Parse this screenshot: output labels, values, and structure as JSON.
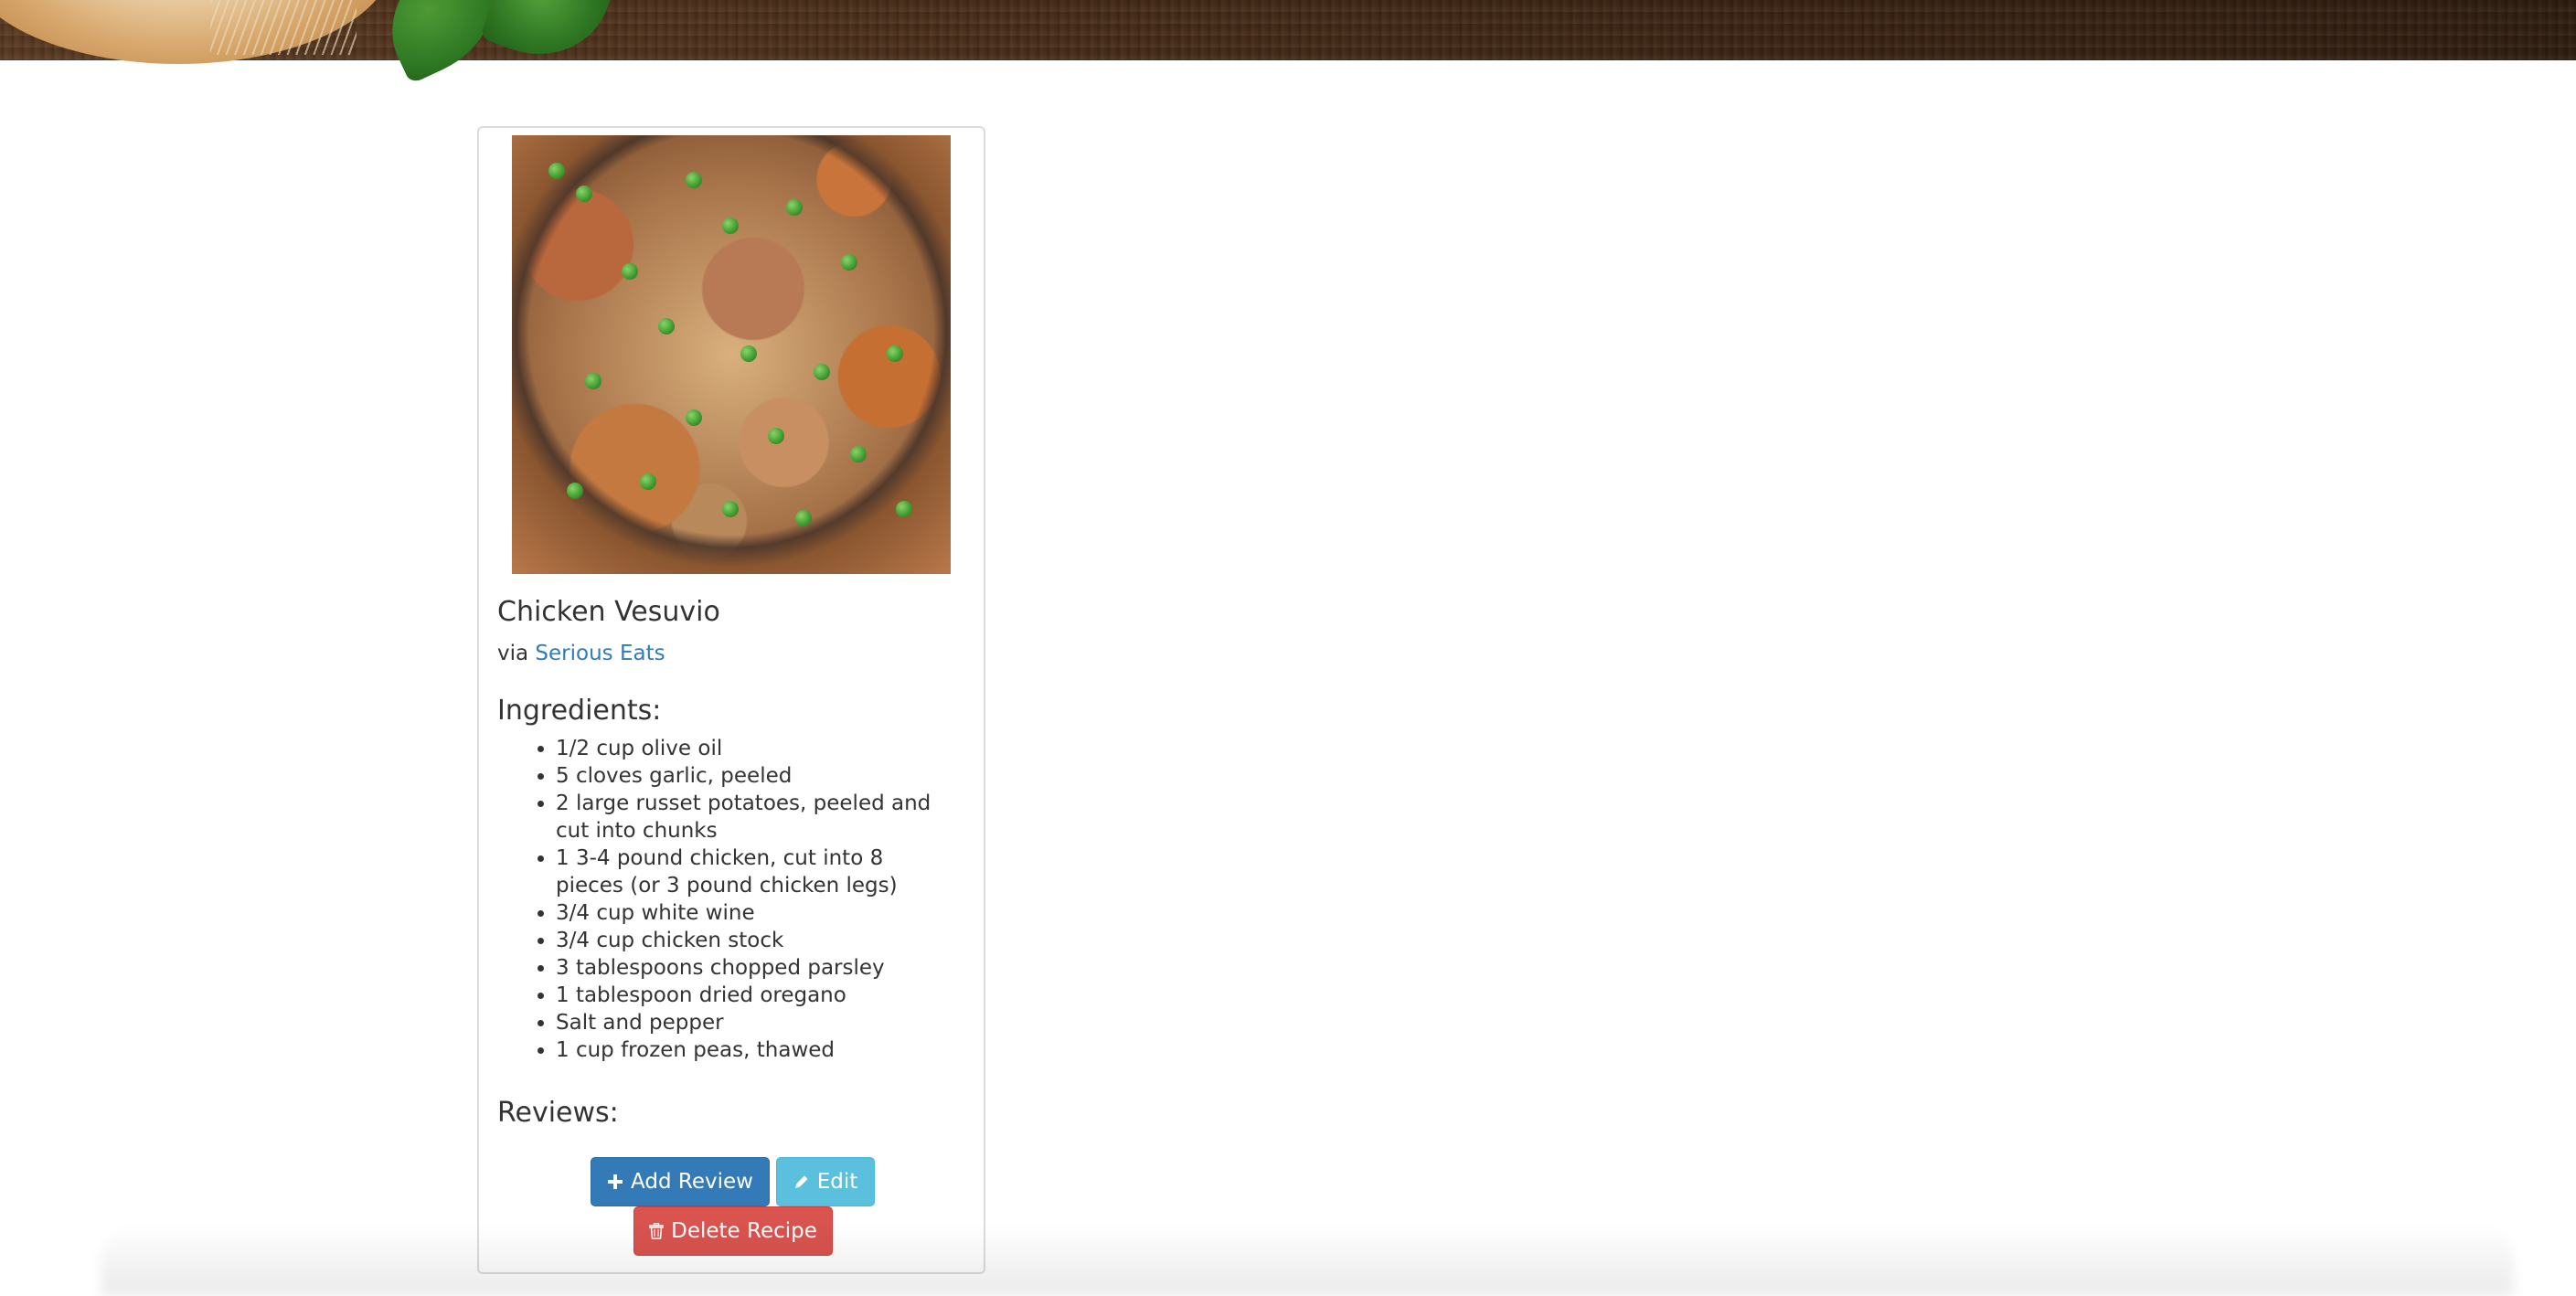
{
  "recipe": {
    "title": "Chicken Vesuvio",
    "via_prefix": "via",
    "source_name": "Serious Eats",
    "ingredients_heading": "Ingredients:",
    "ingredients": [
      "1/2 cup olive oil",
      "5 cloves garlic, peeled",
      "2 large russet potatoes, peeled and cut into chunks",
      "1 3-4 pound chicken, cut into 8 pieces (or 3 pound chicken legs)",
      "3/4 cup white wine",
      "3/4 cup chicken stock",
      "3 tablespoons chopped parsley",
      "1 tablespoon dried oregano",
      "Salt and pepper",
      "1 cup frozen peas, thawed"
    ],
    "reviews_heading": "Reviews:"
  },
  "actions": {
    "add_review_label": "Add Review",
    "edit_label": "Edit",
    "delete_label": "Delete Recipe"
  },
  "icons": {
    "add_review": "plus-icon",
    "edit": "pencil-icon",
    "delete": "trash-icon"
  },
  "colors": {
    "link": "#337ab7",
    "primary": "#337ab7",
    "info": "#5bc0de",
    "danger": "#d9534f"
  }
}
